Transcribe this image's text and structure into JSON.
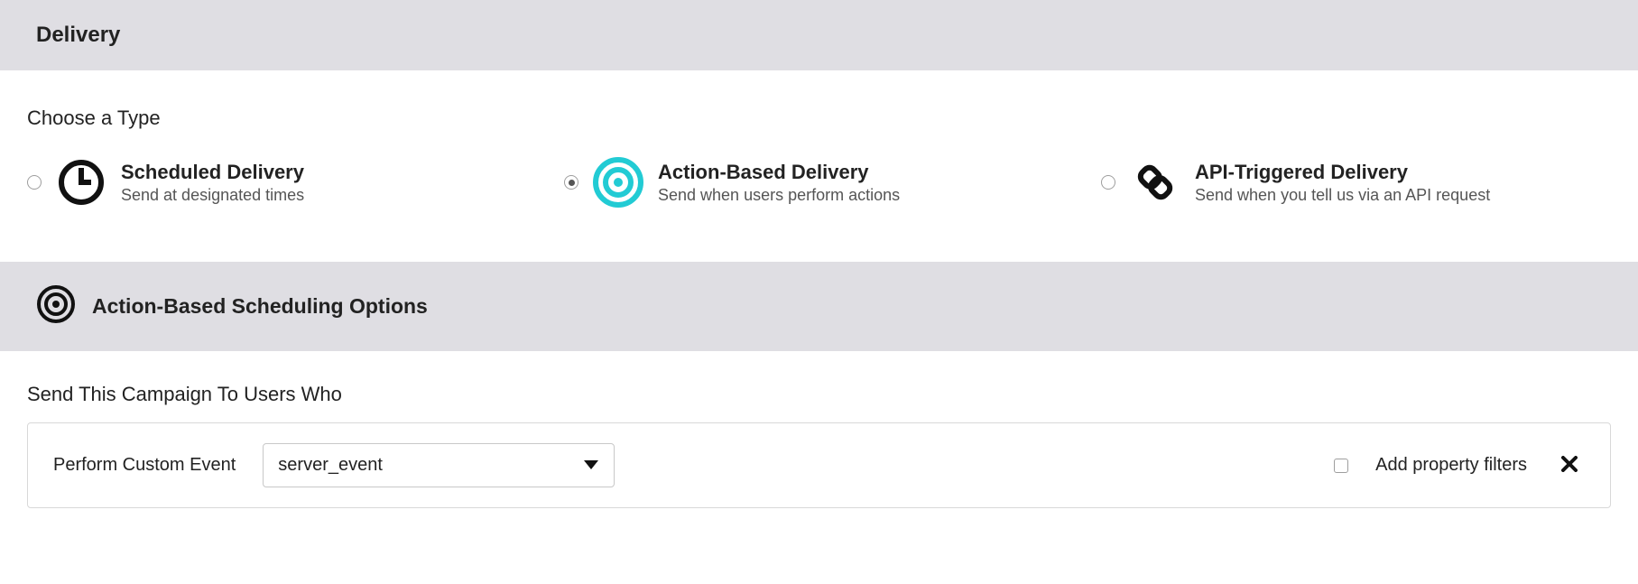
{
  "header": {
    "title": "Delivery"
  },
  "chooseType": {
    "heading": "Choose a Type",
    "options": [
      {
        "title": "Scheduled Delivery",
        "subtitle": "Send at designated times",
        "selected": false
      },
      {
        "title": "Action-Based Delivery",
        "subtitle": "Send when users perform actions",
        "selected": true
      },
      {
        "title": "API-Triggered Delivery",
        "subtitle": "Send when you tell us via an API request",
        "selected": false
      }
    ]
  },
  "scheduling": {
    "heading": "Action-Based Scheduling Options"
  },
  "campaign": {
    "heading": "Send This Campaign To Users Who",
    "rule_label": "Perform Custom Event",
    "event_value": "server_event",
    "add_filters_label": "Add property filters",
    "add_filters_checked": false
  }
}
